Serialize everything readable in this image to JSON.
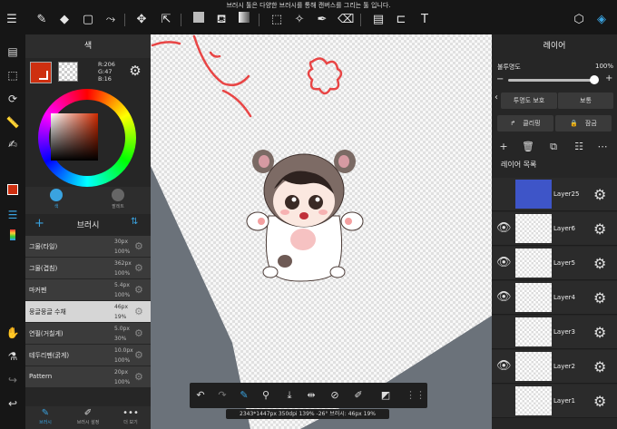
{
  "notice": "브러시 툴은 다양한 브러시를 통해 캔버스를 그리는 툴 입니다.",
  "color_panel": {
    "title": "색",
    "r": "R:206",
    "g": "G:47",
    "b": "B:16",
    "main_color": "#ce2f10",
    "tabs": [
      "색",
      "팔레트"
    ]
  },
  "brush_panel": {
    "title": "브러시",
    "items": [
      {
        "name": "그물(타일)",
        "size": "30px",
        "opacity": "100%"
      },
      {
        "name": "그물(겹침)",
        "size": "362px",
        "opacity": "100%"
      },
      {
        "name": "마커펜",
        "size": "5.4px",
        "opacity": "100%"
      },
      {
        "name": "뭉글뭉글 수채",
        "size": "46px",
        "opacity": "19%"
      },
      {
        "name": "연필(거칠게)",
        "size": "5.0px",
        "opacity": "30%"
      },
      {
        "name": "테두리펜(굵게)",
        "size": "10.0px",
        "opacity": "100%"
      },
      {
        "name": "Pattern",
        "size": "20px",
        "opacity": "100%"
      }
    ],
    "selected_index": 3,
    "bottom_tabs": [
      "브러시",
      "브러시 설정",
      "더 보기"
    ]
  },
  "layer_panel": {
    "title": "레이어",
    "opacity_label": "불투명도",
    "opacity_value": "100%",
    "opacity": 1.0,
    "blend_buttons": [
      "투명도 보호",
      "보통"
    ],
    "clip_label": "클리핑",
    "lock_label": "잠금",
    "list_label": "레이어 목록",
    "layers": [
      {
        "name": "Layer25",
        "visible": false,
        "thumb": "blue"
      },
      {
        "name": "Layer6",
        "visible": true,
        "thumb": "check"
      },
      {
        "name": "Layer5",
        "visible": true,
        "thumb": "check"
      },
      {
        "name": "Layer4",
        "visible": true,
        "thumb": "check"
      },
      {
        "name": "Layer3",
        "visible": false,
        "thumb": "check"
      },
      {
        "name": "Layer2",
        "visible": true,
        "thumb": "check"
      },
      {
        "name": "Layer1",
        "visible": false,
        "thumb": "check"
      }
    ]
  },
  "status": "2343*1447px 350dpi 139% -26° 브러시: 46px 19%"
}
